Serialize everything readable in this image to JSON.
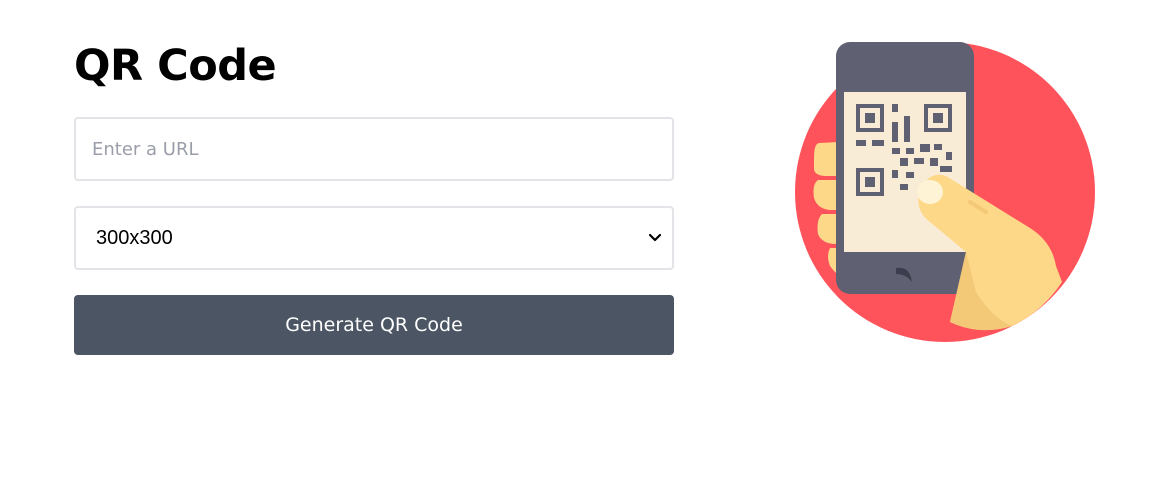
{
  "header": {
    "title": "QR Code"
  },
  "form": {
    "url_placeholder": "Enter a URL",
    "url_value": "",
    "size_selected": "300x300",
    "generate_label": "Generate QR Code"
  },
  "illustration": {
    "icon": "qr-scan-phone-illustration",
    "colors": {
      "circle": "#ff535c",
      "phone": "#5f6072",
      "screen": "#f9ecd7",
      "qr": "#5f6072",
      "hand": "#fdd888"
    }
  },
  "colors": {
    "button": "#4b5563",
    "button_text": "#ffffff",
    "input_border": "#e3e4e8",
    "placeholder": "#9a9ea9"
  }
}
